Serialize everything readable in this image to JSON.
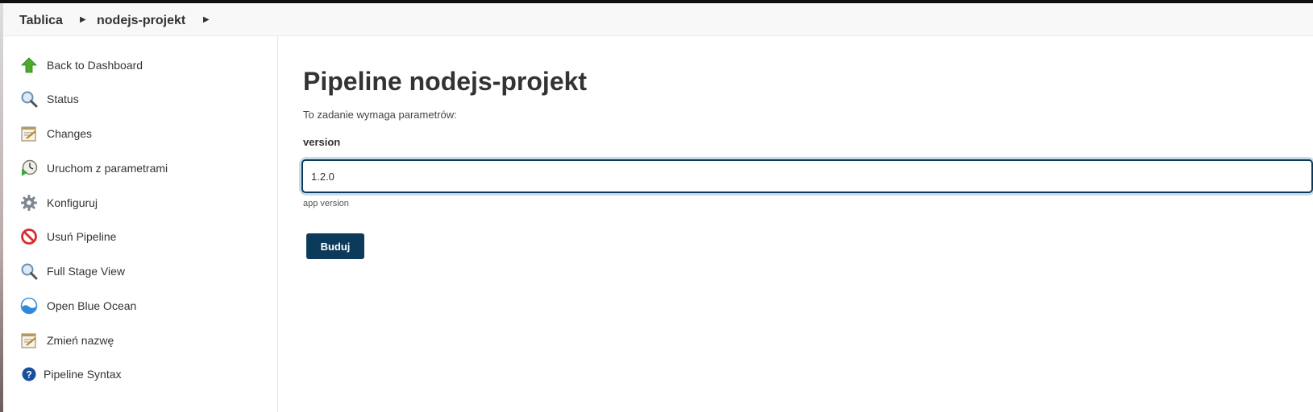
{
  "breadcrumb": {
    "items": [
      {
        "label": "Tablica"
      },
      {
        "label": "nodejs-projekt"
      }
    ]
  },
  "sidebar": {
    "items": [
      {
        "label": "Back to Dashboard",
        "icon": "up-arrow-icon"
      },
      {
        "label": "Status",
        "icon": "magnifier-icon"
      },
      {
        "label": "Changes",
        "icon": "notepad-icon"
      },
      {
        "label": "Uruchom z parametrami",
        "icon": "clock-play-icon"
      },
      {
        "label": "Konfiguruj",
        "icon": "gear-icon"
      },
      {
        "label": "Usuń Pipeline",
        "icon": "no-entry-icon"
      },
      {
        "label": "Full Stage View",
        "icon": "magnifier-icon"
      },
      {
        "label": "Open Blue Ocean",
        "icon": "blue-ocean-icon"
      },
      {
        "label": "Zmień nazwę",
        "icon": "notepad-icon"
      },
      {
        "label": "Pipeline Syntax",
        "icon": "help-icon"
      }
    ]
  },
  "main": {
    "title": "Pipeline nodejs-projekt",
    "description": "To zadanie wymaga parametrów:",
    "parameter": {
      "name": "version",
      "value": "1.2.0",
      "help": "app version"
    },
    "build_button": "Buduj"
  },
  "colors": {
    "accent": "#0c3a5a",
    "focus_ring": "#c6dcea"
  }
}
